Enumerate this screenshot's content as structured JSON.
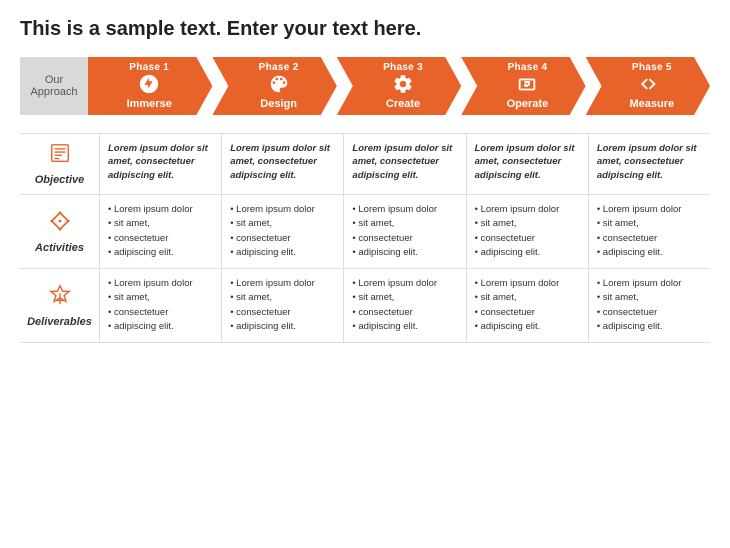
{
  "title": "This is a sample text. Enter your text here.",
  "approachLabel": "Our\nApproach",
  "phases": [
    {
      "id": 1,
      "label": "Phase 1",
      "name": "Immerse",
      "icon": "🔍",
      "iconType": "immerse"
    },
    {
      "id": 2,
      "label": "Phase 2",
      "name": "Design",
      "icon": "🎨",
      "iconType": "design"
    },
    {
      "id": 3,
      "label": "Phase 3",
      "name": "Create",
      "icon": "⚙",
      "iconType": "create"
    },
    {
      "id": 4,
      "label": "Phase 4",
      "name": "Operate",
      "icon": "📊",
      "iconType": "operate"
    },
    {
      "id": 5,
      "label": "Phase 5",
      "name": "Measure",
      "icon": "↔",
      "iconType": "measure"
    }
  ],
  "rows": [
    {
      "id": "objective",
      "label": "Objective",
      "icon": "objective",
      "type": "objective",
      "cells": [
        "Lorem ipsum dolor sit amet, consectetuer adipiscing elit.",
        "Lorem ipsum dolor sit amet, consectetuer adipiscing elit.",
        "Lorem ipsum dolor sit amet, consectetuer adipiscing elit.",
        "Lorem ipsum dolor sit amet, consectetuer adipiscing elit.",
        "Lorem ipsum dolor sit amet, consectetuer adipiscing elit."
      ]
    },
    {
      "id": "activities",
      "label": "Activities",
      "icon": "activities",
      "type": "bullet",
      "cells": [
        [
          "Lorem ipsum dolor",
          "sit amet,",
          "consectetuer",
          "adipiscing elit."
        ],
        [
          "Lorem ipsum dolor",
          "sit amet,",
          "consectetuer",
          "adipiscing elit."
        ],
        [
          "Lorem ipsum dolor",
          "sit amet,",
          "consectetuer",
          "adipiscing elit."
        ],
        [
          "Lorem ipsum dolor",
          "sit amet,",
          "consectetuer",
          "adipiscing elit."
        ],
        [
          "Lorem ipsum dolor",
          "sit amet,",
          "consectetuer",
          "adipiscing elit."
        ]
      ]
    },
    {
      "id": "deliverables",
      "label": "Deliverables",
      "icon": "deliverables",
      "type": "bullet",
      "cells": [
        [
          "Lorem ipsum dolor",
          "sit amet,",
          "consectetuer",
          "adipiscing elit."
        ],
        [
          "Lorem ipsum dolor",
          "sit amet,",
          "consectetuer",
          "adipiscing elit."
        ],
        [
          "Lorem ipsum dolor",
          "sit amet,",
          "consectetuer",
          "adipiscing elit."
        ],
        [
          "Lorem ipsum dolor",
          "sit amet,",
          "consectetuer",
          "adipiscing elit."
        ],
        [
          "Lorem ipsum dolor",
          "sit amet,",
          "consectetuer",
          "adipiscing elit."
        ]
      ]
    }
  ],
  "colors": {
    "orange": "#e8632a",
    "grey": "#bbb",
    "darkgrey": "#d9d9d9"
  }
}
